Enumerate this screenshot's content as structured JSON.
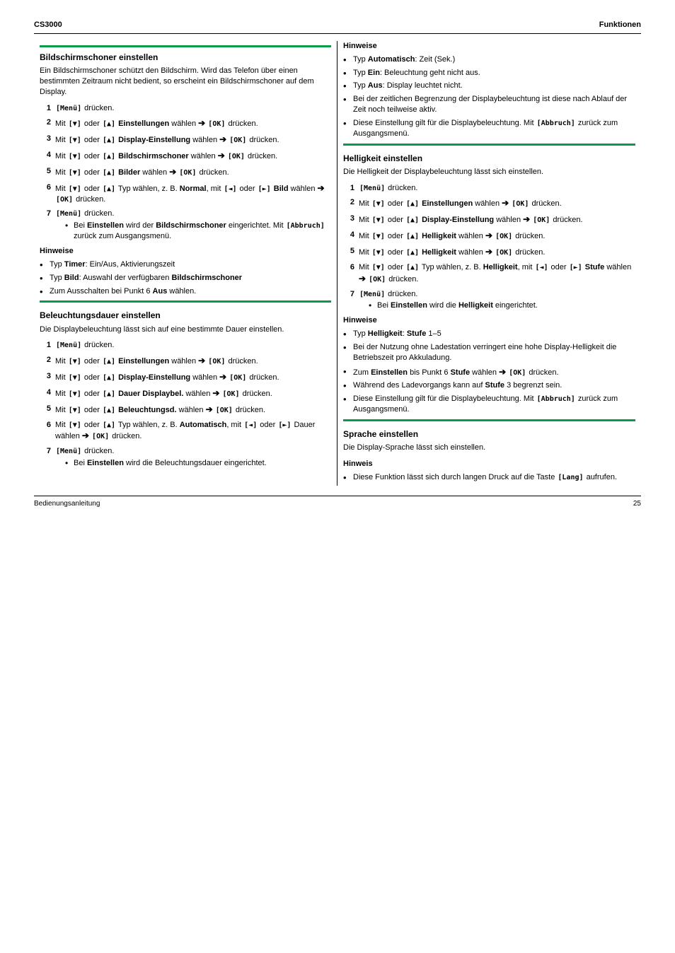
{
  "header": {
    "left": "CS3000",
    "right": "Funktionen"
  },
  "icons": {
    "menu": "[Menü]",
    "ok": "[OK]",
    "down": "[▼]",
    "up": "[▲]",
    "left": "[◄]",
    "right": "[►]",
    "arrow": "➔",
    "cancel": "[Abbruch]",
    "lang": "[Lang]"
  },
  "sections": {
    "a": {
      "title": "Bildschirmschoner einstellen",
      "intro": "Ein Bildschirmschoner schützt den Bildschirm. Wird das Telefon über einen bestimmten Zeitraum nicht bedient, so erscheint ein Bildschirmschoner auf dem Display.",
      "steps": [
        {
          "text": "{menu} drücken."
        },
        {
          "text": "Mit {down} oder {up} Einstellungen wählen {arrow} {ok} drücken."
        },
        {
          "text": "Mit {down} oder {up} Display-Einstellung wählen {arrow} {ok} drücken."
        },
        {
          "text": "Mit {down} oder {up} Bildschirmschoner wählen {arrow} {ok} drücken."
        },
        {
          "text": "Mit {down} oder {up} Bilder wählen {arrow} {ok} drücken."
        },
        {
          "text": "Mit {down} oder {up} Typ wählen, z. B. Normal, mit {left} oder {right} Bild wählen {arrow} {ok} drücken."
        },
        {
          "text": "{menu} drücken.",
          "inner": [
            "Bei Einstellen wird der Bildschirmschoner eingerichtet. Mit {cancel} zurück zum Ausgangsmenü."
          ]
        }
      ],
      "notes_label": "Hinweise",
      "notes": [
        "Typ Timer: Ein/Aus, Aktivierungszeit",
        "Typ Bild: Auswahl der verfügbaren Bildschirmschoner",
        "Zum Ausschalten bei Punkt 6 Aus wählen."
      ]
    },
    "b": {
      "title": "Beleuchtungsdauer einstellen",
      "intro": "Die Displaybeleuchtung lässt sich auf eine bestimmte Dauer einstellen.",
      "steps": [
        {
          "text": "{menu} drücken."
        },
        {
          "text": "Mit {down} oder {up} Einstellungen wählen {arrow} {ok} drücken."
        },
        {
          "text": "Mit {down} oder {up} Display-Einstellung wählen {arrow} {ok} drücken."
        },
        {
          "text": "Mit {down} oder {up} Dauer Displaybel. wählen {arrow} {ok} drücken."
        },
        {
          "text": "Mit {down} oder {up} Beleuchtungsd. wählen {arrow} {ok} drücken."
        },
        {
          "text": "Mit {down} oder {up} Typ wählen, z. B. Automatisch, mit {left} oder {right} Dauer wählen {arrow} {ok} drücken."
        },
        {
          "text": "{menu} drücken.",
          "inner": [
            "Bei Einstellen wird die Beleuchtungsdauer eingerichtet."
          ]
        }
      ],
      "notes_label": "Hinweise",
      "notes": [
        "Typ Automatisch: Zeit (Sek.)",
        "Typ Ein: Beleuchtung geht nicht aus.",
        "Typ Aus: Display leuchtet nicht.",
        "Bei der zeitlichen Begrenzung der Displaybeleuchtung ist diese nach Ablauf der Zeit noch teilweise aktiv.",
        "Diese Einstellung gilt für die Displaybeleuchtung. Mit {cancel} zurück zum Ausgangsmenü."
      ]
    },
    "c": {
      "title": "Helligkeit einstellen",
      "intro": "Die Helligkeit der Displaybeleuchtung lässt sich einstellen.",
      "steps": [
        {
          "text": "{menu} drücken."
        },
        {
          "text": "Mit {down} oder {up} Einstellungen wählen {arrow} {ok} drücken."
        },
        {
          "text": "Mit {down} oder {up} Display-Einstellung wählen {arrow} {ok} drücken."
        },
        {
          "text": "Mit {down} oder {up} Helligkeit wählen {arrow} {ok} drücken."
        },
        {
          "text": "Mit {down} oder {up} Helligkeit wählen {arrow} {ok} drücken."
        },
        {
          "text": "Mit {down} oder {up} Typ wählen, z. B. Helligkeit, mit {left} oder {right} Stufe wählen {arrow} {ok} drücken."
        },
        {
          "text": "{menu} drücken.",
          "inner": [
            "Bei Einstellen wird die Helligkeit eingerichtet."
          ]
        }
      ],
      "notes_label": "Hinweise",
      "notes": [
        "Typ Helligkeit: Stufe 1–5",
        "Bei der Nutzung ohne Ladestation verringert eine hohe Display-Helligkeit die Betriebszeit pro Akkuladung.",
        "Zum Einstellen bis Punkt 6 Stufe wählen {arrow} {ok} drücken.",
        "Während des Ladevorgangs kann auf Stufe 3 begrenzt sein.",
        "Diese Einstellung gilt für die Displaybeleuchtung. Mit {cancel} zurück zum Ausgangsmenü."
      ]
    },
    "d": {
      "title": "Sprache einstellen",
      "intro": "Die Display-Sprache lässt sich einstellen.",
      "notes_label": "Hinweis",
      "notes": [
        "Diese Funktion lässt sich durch langen Druck auf die Taste {lang} aufrufen."
      ]
    }
  },
  "footer": {
    "left": "Bedienungsanleitung",
    "right": "25"
  }
}
